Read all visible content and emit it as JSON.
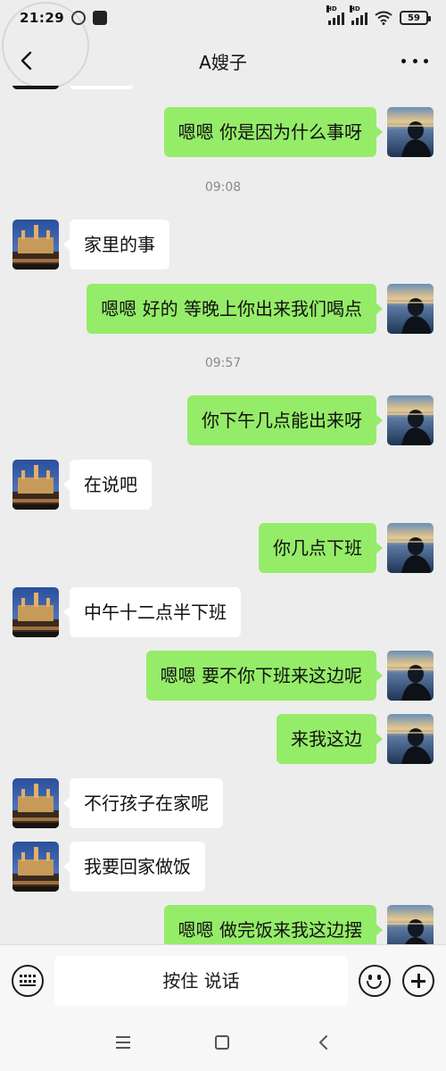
{
  "status_bar": {
    "time": "21:29",
    "network_label": "HD",
    "battery": "59"
  },
  "header": {
    "title": "A嫂子"
  },
  "messages": [
    {
      "text": "嗯嗯  你是因为什么事呀"
    },
    {
      "text": "家里的事"
    },
    {
      "text": "嗯嗯  好的  等晚上你出来我们喝点"
    },
    {
      "text": "你下午几点能出来呀"
    },
    {
      "text": "在说吧"
    },
    {
      "text": "你几点下班"
    },
    {
      "text": "中午十二点半下班"
    },
    {
      "text": "嗯嗯  要不你下班来这边呢"
    },
    {
      "text": "来我这边"
    },
    {
      "text": "不行孩子在家呢"
    },
    {
      "text": "我要回家做饭"
    },
    {
      "text": "嗯嗯   做完饭来我这边摆"
    }
  ],
  "timestamps": [
    "09:08",
    "09:57"
  ],
  "input_bar": {
    "hold_to_talk_label": "按住 说话"
  },
  "icons": {
    "back": "back-arrow-icon",
    "more": "more-dots-icon",
    "voice": "keyboard-icon",
    "emoji": "emoji-icon",
    "plus": "plus-icon"
  },
  "colors": {
    "outgoing_bubble": "#95ec69",
    "incoming_bubble": "#ffffff",
    "background": "#ededed"
  }
}
